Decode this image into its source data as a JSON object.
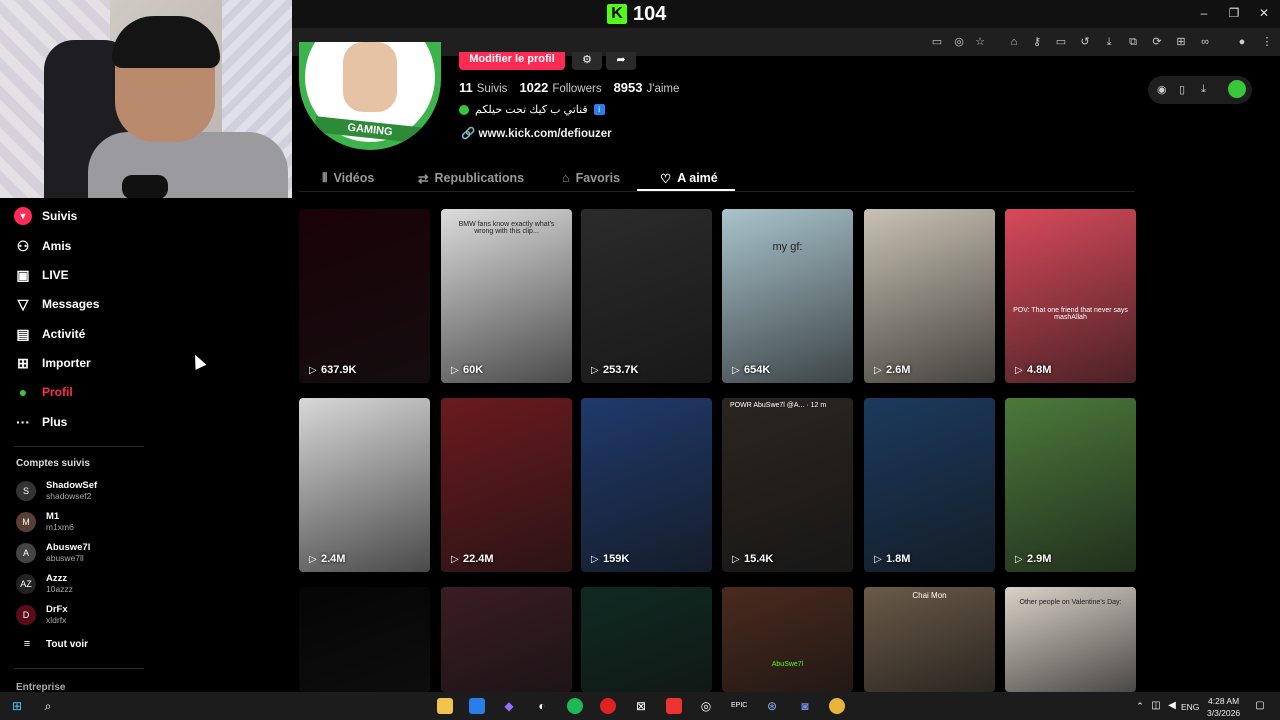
{
  "topbar": {
    "logo_letter": "K",
    "viewer_count": "104",
    "minimize": "–",
    "restore": "❐",
    "close": "✕"
  },
  "profile": {
    "edit_button": "Modifier le profil",
    "settings_icon": "⚙",
    "share_icon": "➦",
    "avatar_banner": "GAMING",
    "stats": [
      {
        "value": "11",
        "label": "Suivis"
      },
      {
        "value": "1022",
        "label": "Followers"
      },
      {
        "value": "8953",
        "label": "J'aime"
      }
    ],
    "bio": "قناتي ب كيك تحت حيلكم",
    "link": "www.kick.com/defiouzer"
  },
  "tabs": [
    {
      "label": "Vidéos",
      "icon": "⦀"
    },
    {
      "label": "Republications",
      "icon": "⇄"
    },
    {
      "label": "Favoris",
      "icon": "⌂"
    },
    {
      "label": "A aimé",
      "icon": "♡"
    }
  ],
  "sidebar": {
    "nav": [
      {
        "label": "Suivis",
        "icon": "▼"
      },
      {
        "label": "Amis",
        "icon": "⚇"
      },
      {
        "label": "LIVE",
        "icon": "▣"
      },
      {
        "label": "Messages",
        "icon": "▽"
      },
      {
        "label": "Activité",
        "icon": "▤"
      },
      {
        "label": "Importer",
        "icon": "⊞"
      },
      {
        "label": "Profil",
        "icon": "●"
      },
      {
        "label": "Plus",
        "icon": "···"
      }
    ],
    "following_title": "Comptes suivis",
    "accounts": [
      {
        "name": "ShadowSef",
        "handle": "shadowsef2",
        "initial": "S"
      },
      {
        "name": "M1",
        "handle": "m1xm6",
        "initial": "M"
      },
      {
        "name": "Abuswe7l",
        "handle": "abuswe7ll",
        "initial": "A"
      },
      {
        "name": "Azzz",
        "handle": "10azzz",
        "initial": "AZ"
      },
      {
        "name": "DrFx",
        "handle": "xldrfx",
        "initial": "D"
      }
    ],
    "see_all": "Tout voir",
    "see_all_icon": "≡",
    "footer": "Entreprise"
  },
  "videos": [
    {
      "views": "637.9K",
      "bg": "#1a0208"
    },
    {
      "views": "60K",
      "bg": "#dcdcdc",
      "caption": "BMW fans know exactly what's wrong with this clip..."
    },
    {
      "views": "253.7K",
      "bg": "#2b2b2b"
    },
    {
      "views": "654K",
      "bg": "#a9c4cc",
      "caption": "my gf:"
    },
    {
      "views": "2.6M",
      "bg": "#c9c2b4"
    },
    {
      "views": "4.8M",
      "bg": "#d84a5a",
      "caption": "POV: That one friend that never says mashAllah"
    },
    {
      "views": "2.4M",
      "bg": "#d8d8d8"
    },
    {
      "views": "22.4M",
      "bg": "#6b1a1f"
    },
    {
      "views": "159K",
      "bg": "#1f3a6b"
    },
    {
      "views": "15.4K",
      "bg": "#2a2520",
      "caption": "POWR AbuSwe7l @A... · 12 m"
    },
    {
      "views": "1.8M",
      "bg": "#1b3a5e"
    },
    {
      "views": "2.9M",
      "bg": "#4b7a3a"
    },
    {
      "views": "",
      "bg": "#050505"
    },
    {
      "views": "",
      "bg": "#3a1c24"
    },
    {
      "views": "",
      "bg": "#0f2a22"
    },
    {
      "views": "",
      "bg": "#4a2a1e",
      "caption": "AbuSwe7l"
    },
    {
      "views": "",
      "bg": "#6a5a48",
      "caption": "Chai Mon"
    },
    {
      "views": "",
      "bg": "#d9d2c8",
      "caption": "Other people on Valentine's Day:"
    }
  ],
  "taskbar": {
    "lang": "ENG",
    "time": "4:28 AM",
    "date": "3/3/2026"
  },
  "colors": {
    "accent": "#fe2c55",
    "kick_green": "#53fc18"
  }
}
